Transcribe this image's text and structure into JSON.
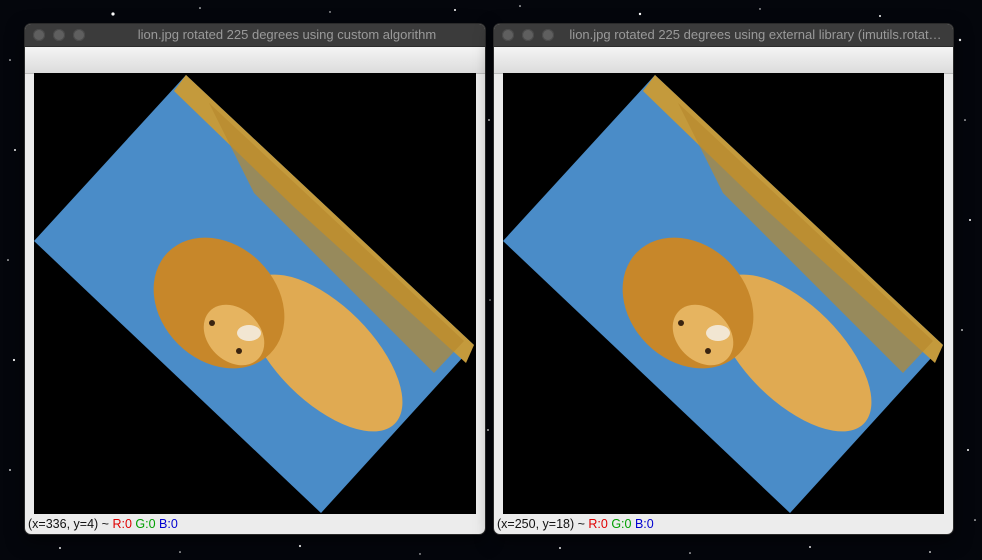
{
  "windows": [
    {
      "title": "lion.jpg rotated 225 degrees using custom algorithm",
      "status": {
        "coords": "(x=336, y=4) ~",
        "r": "R:0",
        "g": "G:0",
        "b": "B:0"
      }
    },
    {
      "title": "lion.jpg rotated 225 degrees using external library (imutils.rotat…",
      "status": {
        "coords": "(x=250, y=18) ~",
        "r": "R:0",
        "g": "G:0",
        "b": "B:0"
      }
    }
  ],
  "colors": {
    "sky": "#4a8cc8",
    "grass": "#c49a3c",
    "lion_mane": "#c7872a",
    "lion_body": "#e0aa52",
    "canvas_bg": "#000000"
  }
}
